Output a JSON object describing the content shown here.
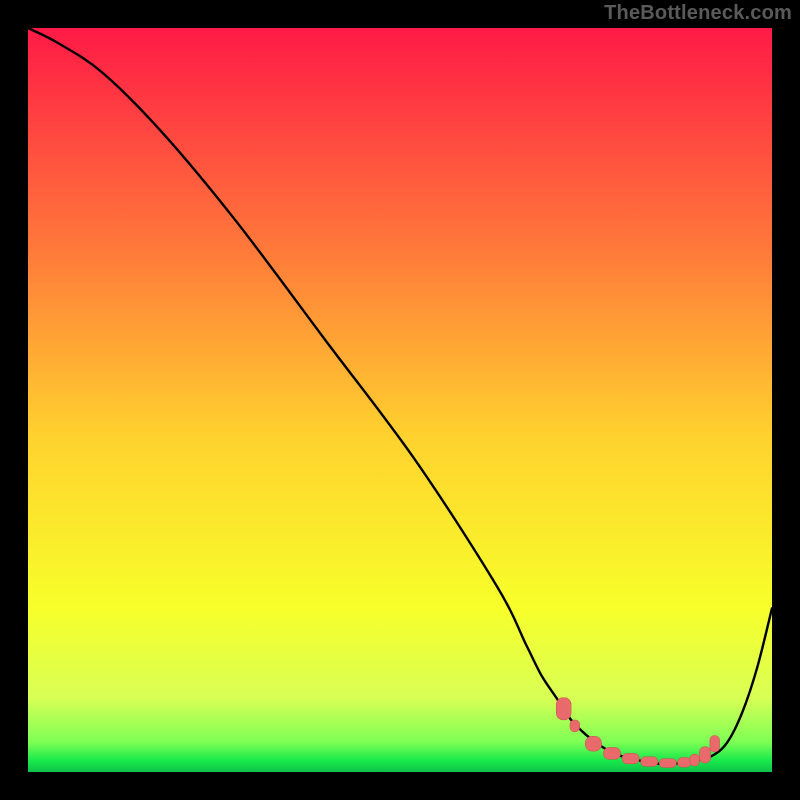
{
  "watermark": "TheBottleneck.com",
  "colors": {
    "frame": "#000000",
    "grad_top": "#ff1a46",
    "grad_upper_mid": "#ff7a3a",
    "grad_mid": "#ffd22e",
    "grad_lower_mid": "#f7ff2a",
    "grad_band": "#d9ff55",
    "grad_green": "#17e84b",
    "grad_green2": "#0fc24a",
    "curve": "#000000",
    "marker_fill": "#e86a6a",
    "marker_stroke": "#c94f4f"
  },
  "chart_data": {
    "type": "line",
    "title": "",
    "xlabel": "",
    "ylabel": "",
    "xlim": [
      0,
      100
    ],
    "ylim": [
      0,
      100
    ],
    "series": [
      {
        "name": "bottleneck-curve",
        "x": [
          0,
          4,
          10,
          18,
          28,
          40,
          52,
          63,
          67,
          69,
          71,
          73,
          75,
          77,
          79,
          81,
          83,
          84,
          85,
          86.5,
          88,
          89.5,
          92,
          94,
          96,
          98,
          100
        ],
        "y": [
          100,
          98,
          94,
          86,
          74,
          58,
          42,
          25,
          17,
          13,
          10,
          7,
          5,
          3.5,
          2.4,
          1.8,
          1.4,
          1.2,
          1.1,
          1.1,
          1.2,
          1.5,
          2.2,
          4,
          8,
          14,
          22
        ]
      }
    ],
    "markers": {
      "name": "optimal-range",
      "points": [
        {
          "x": 72,
          "y": 8.5,
          "w": 2.0,
          "h": 3.0
        },
        {
          "x": 73.5,
          "y": 6.2,
          "w": 1.3,
          "h": 1.6
        },
        {
          "x": 76,
          "y": 3.8,
          "w": 2.2,
          "h": 2.0
        },
        {
          "x": 78.5,
          "y": 2.5,
          "w": 2.3,
          "h": 1.6
        },
        {
          "x": 81,
          "y": 1.8,
          "w": 2.3,
          "h": 1.4
        },
        {
          "x": 83.5,
          "y": 1.4,
          "w": 2.3,
          "h": 1.3
        },
        {
          "x": 86,
          "y": 1.2,
          "w": 2.3,
          "h": 1.2
        },
        {
          "x": 88.2,
          "y": 1.3,
          "w": 1.8,
          "h": 1.3
        },
        {
          "x": 89.6,
          "y": 1.6,
          "w": 1.3,
          "h": 1.6
        },
        {
          "x": 91,
          "y": 2.3,
          "w": 1.5,
          "h": 2.2
        },
        {
          "x": 92.3,
          "y": 3.8,
          "w": 1.3,
          "h": 2.2
        }
      ]
    }
  }
}
